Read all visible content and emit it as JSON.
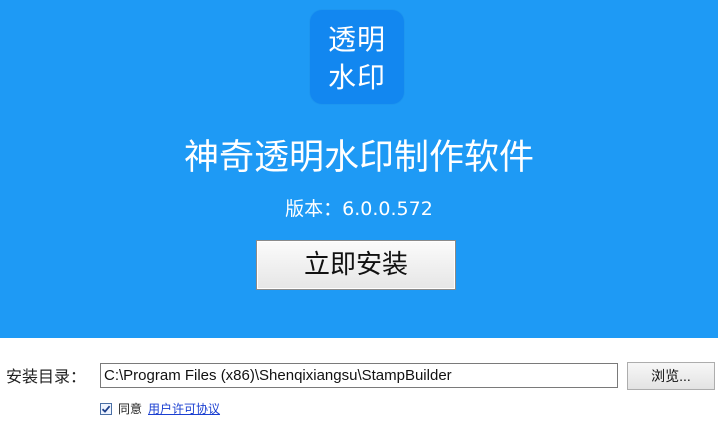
{
  "app": {
    "logo_line1": "透明",
    "logo_line2": "水印",
    "title": "神奇透明水印制作软件",
    "version_label": "版本：6.0.0.572",
    "install_button": "立即安装"
  },
  "install_dir": {
    "label": "安装目录：",
    "value": "C:\\Program Files (x86)\\Shenqixiangsu\\StampBuilder",
    "browse_button": "浏览..."
  },
  "agreement": {
    "checked": true,
    "agree_text": "同意",
    "license_link": "用户许可协议"
  },
  "colors": {
    "hero_background": "#1e9af5",
    "logo_background": "#1287f0",
    "link": "#1a3fd1"
  }
}
